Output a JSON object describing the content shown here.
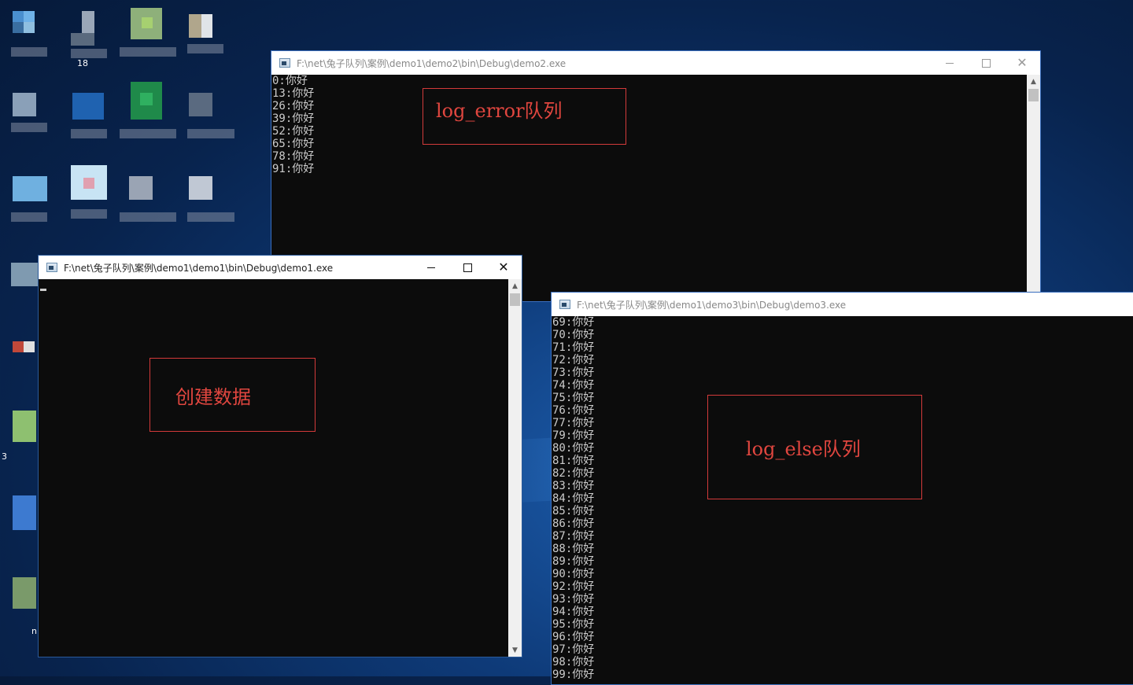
{
  "desktop": {
    "icon_fragments": [
      "18",
      "3",
      "n"
    ]
  },
  "windows": {
    "demo2": {
      "title": "F:\\net\\兔子队列\\案例\\demo1\\demo2\\bin\\Debug\\demo2.exe",
      "lines": [
        "0:你好",
        "13:你好",
        "26:你好",
        "39:你好",
        "52:你好",
        "65:你好",
        "78:你好",
        "91:你好"
      ],
      "annotation": "log_error队列"
    },
    "demo1": {
      "title": "F:\\net\\兔子队列\\案例\\demo1\\demo1\\bin\\Debug\\demo1.exe",
      "annotation": "创建数据"
    },
    "demo3": {
      "title": "F:\\net\\兔子队列\\案例\\demo1\\demo3\\bin\\Debug\\demo3.exe",
      "lines": [
        "69:你好",
        "70:你好",
        "71:你好",
        "72:你好",
        "73:你好",
        "74:你好",
        "75:你好",
        "76:你好",
        "77:你好",
        "79:你好",
        "80:你好",
        "81:你好",
        "82:你好",
        "83:你好",
        "84:你好",
        "85:你好",
        "86:你好",
        "87:你好",
        "88:你好",
        "89:你好",
        "90:你好",
        "92:你好",
        "93:你好",
        "94:你好",
        "95:你好",
        "96:你好",
        "97:你好",
        "98:你好",
        "99:你好"
      ],
      "annotation": "log_else队列"
    }
  },
  "controls": {
    "minimize": "minimize",
    "maximize": "maximize",
    "close": "close"
  },
  "colors": {
    "console_bg": "#0c0c0c",
    "console_text": "#cccccc",
    "annotation_red": "#e0463f",
    "desktop_blue": "#0e3a78"
  }
}
